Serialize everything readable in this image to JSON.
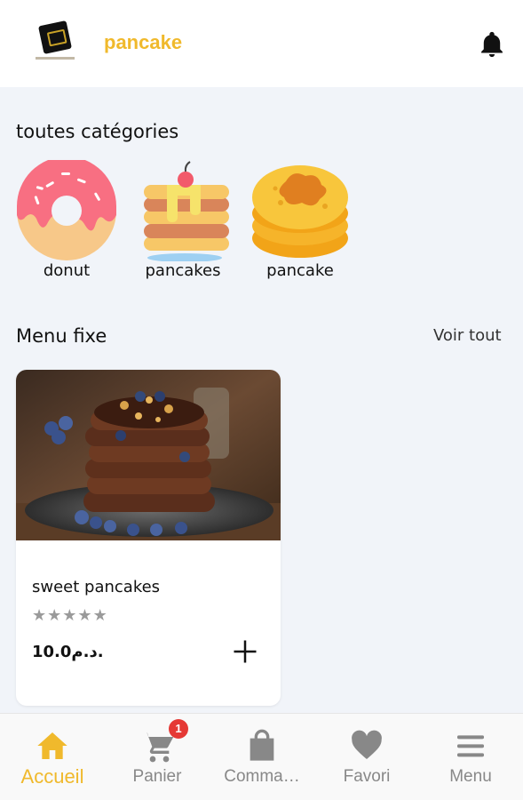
{
  "header": {
    "brand": "pancake"
  },
  "categories": {
    "title": "toutes catégories",
    "items": [
      {
        "label": "donut",
        "icon": "donut-icon"
      },
      {
        "label": "pancakes",
        "icon": "pancake-stack-icon"
      },
      {
        "label": "pancake",
        "icon": "pancake-icon"
      }
    ]
  },
  "menu_fixe": {
    "title": "Menu fixe",
    "see_all": "Voir tout",
    "products": [
      {
        "name": "sweet pancakes",
        "rating": 0,
        "rating_max": 5,
        "price": "10.0د.م."
      }
    ]
  },
  "bottom_nav": {
    "items": [
      {
        "label": "Accueil",
        "icon": "home-icon",
        "active": true
      },
      {
        "label": "Panier",
        "icon": "cart-icon",
        "badge": "1"
      },
      {
        "label": "Comma…",
        "icon": "shopping-bag-icon"
      },
      {
        "label": "Favori",
        "icon": "heart-icon"
      },
      {
        "label": "Menu",
        "icon": "hamburger-menu-icon"
      }
    ]
  },
  "colors": {
    "accent": "#f0b92c",
    "badge": "#e53935",
    "background": "#f1f4f9"
  }
}
